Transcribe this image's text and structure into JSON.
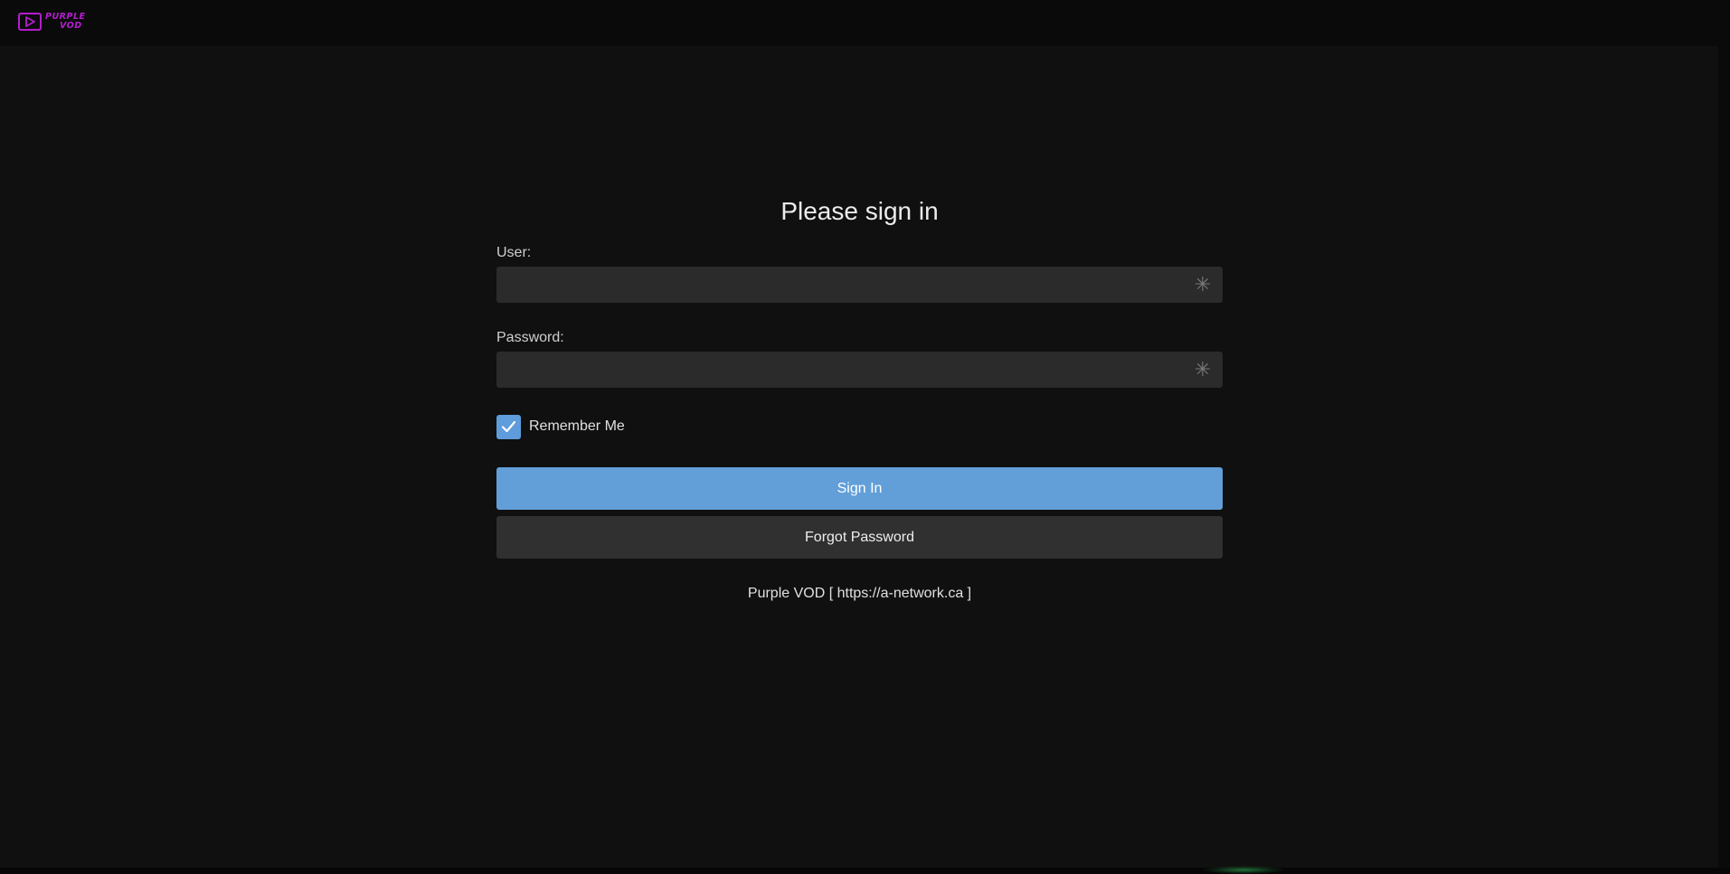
{
  "header": {
    "logo": {
      "icon": "play-icon",
      "line1": "PURPLE",
      "line2": "VOD",
      "color": "#b51ccf"
    }
  },
  "signin": {
    "title": "Please sign in",
    "user_label": "User:",
    "user_value": "",
    "password_label": "Password:",
    "password_value": "",
    "required_icon": "asterisk-icon",
    "remember_label": "Remember Me",
    "remember_checked": true,
    "sign_in_label": "Sign In",
    "forgot_label": "Forgot Password",
    "footer_text": "Purple VOD [ https://a-network.ca ]"
  },
  "colors": {
    "background": "#101010",
    "topbar": "#0a0a0a",
    "field": "#2b2b2b",
    "primary": "#629fd9",
    "secondary": "#303030",
    "checkbox": "#5f9cdb"
  }
}
